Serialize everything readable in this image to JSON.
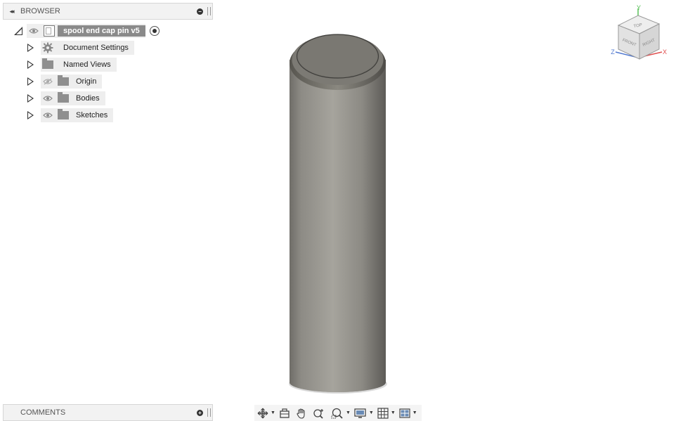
{
  "browser": {
    "title": "BROWSER",
    "collapse_glyph": "◂◂",
    "component": "spool end cap pin v5",
    "items": [
      {
        "label": "Document Settings",
        "icon": "gear-icon"
      },
      {
        "label": "Named Views",
        "icon": "folder-icon"
      },
      {
        "label": "Origin",
        "icon": "folder-icon",
        "visibility": "hidden-eye-icon"
      },
      {
        "label": "Bodies",
        "icon": "folder-icon",
        "visibility": "eye-icon"
      },
      {
        "label": "Sketches",
        "icon": "folder-icon",
        "visibility": "eye-icon"
      }
    ]
  },
  "comments": {
    "title": "COMMENTS"
  },
  "viewcube": {
    "top": "TOP",
    "front": "FRONT",
    "right": "RIGHT",
    "axis_x": "X",
    "axis_y": "Y",
    "axis_z": "Z"
  },
  "toolbar": {
    "tools": [
      "orbit-icon",
      "look-at-icon",
      "pan-icon",
      "zoom-icon",
      "zoom-window-icon",
      "display-settings-icon",
      "grid-icon",
      "viewports-icon"
    ]
  },
  "colors": {
    "panel_bg": "#f2f2f2",
    "axis_x": "#e05050",
    "axis_y": "#58c058",
    "axis_z": "#5078d0",
    "body": "#9c9a93"
  }
}
